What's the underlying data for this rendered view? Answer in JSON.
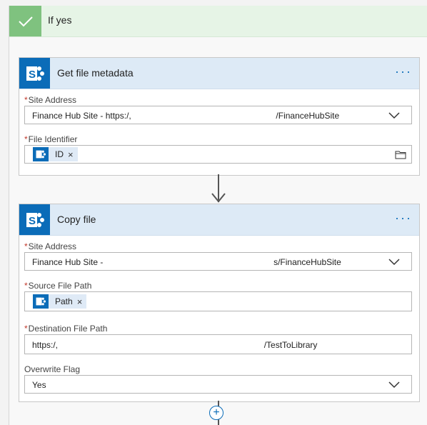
{
  "condition": {
    "title": "If yes"
  },
  "get_file_metadata": {
    "title": "Get file metadata",
    "more_label": "···",
    "site_address": {
      "label": "Site Address",
      "value_prefix": "Finance Hub Site - https:/,",
      "value_suffix": "/FinanceHubSite"
    },
    "file_identifier": {
      "label": "File Identifier",
      "token": "ID"
    }
  },
  "copy_file": {
    "title": "Copy file",
    "more_label": "···",
    "site_address": {
      "label": "Site Address",
      "value_prefix": "Finance Hub Site -",
      "value_suffix": "s/FinanceHubSite"
    },
    "source_file_path": {
      "label": "Source File Path",
      "token": "Path"
    },
    "destination_file_path": {
      "label": "Destination File Path",
      "value_prefix": "https:/,",
      "value_suffix": "/TestToLibrary"
    },
    "overwrite_flag": {
      "label": "Overwrite Flag",
      "value": "Yes"
    }
  },
  "colors": {
    "sharepoint_blue": "#0b6cb8",
    "card_header": "#ddeaf6",
    "yes_header": "#e6f4e6",
    "yes_check": "#7fc27f",
    "required": "#c0392b"
  },
  "icons": [
    "checkmark-icon",
    "sharepoint-icon",
    "more-icon",
    "chevron-down-icon",
    "folder-icon",
    "remove-token-icon",
    "arrow-down-icon",
    "add-step-icon"
  ]
}
